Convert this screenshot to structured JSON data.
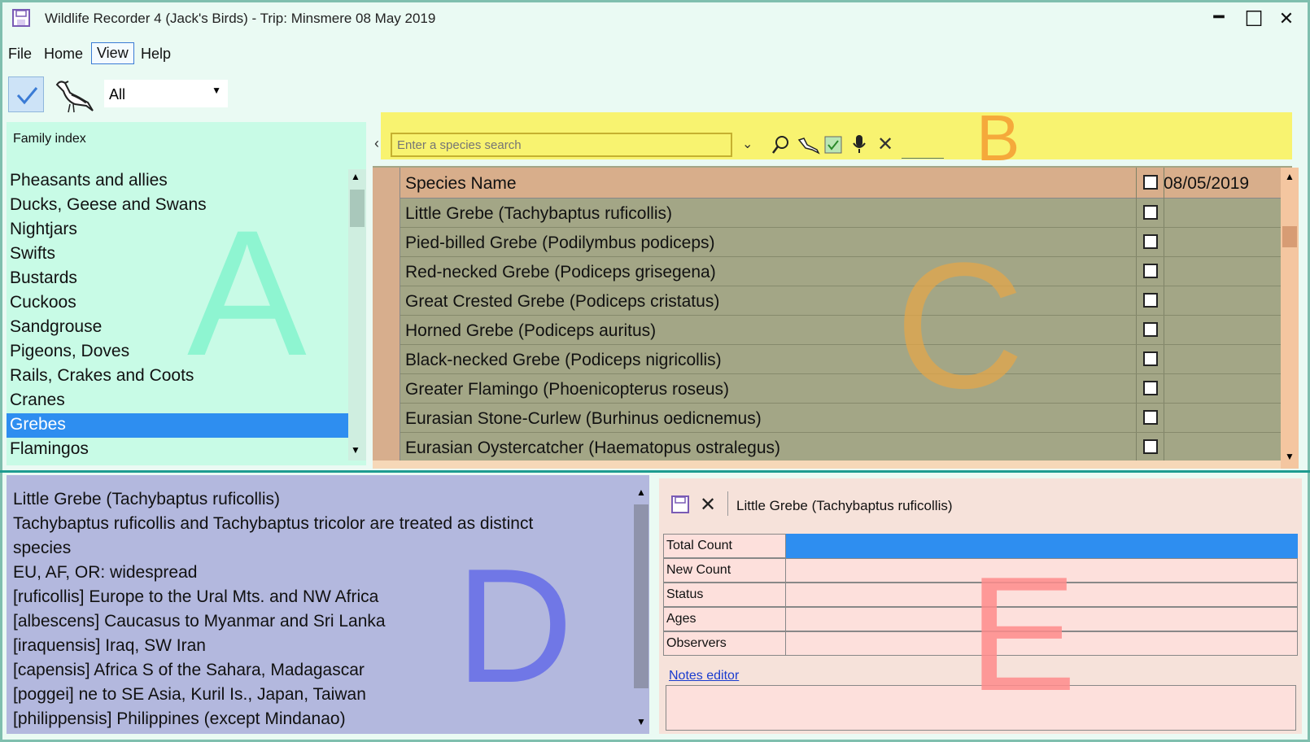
{
  "window": {
    "title": "Wildlife Recorder 4 (Jack's Birds) - Trip: Minsmere 08 May 2019",
    "minimize": "━",
    "maximize": "☐",
    "close": "✕"
  },
  "menu": {
    "items": [
      {
        "label": "File"
      },
      {
        "label": "Home"
      },
      {
        "label": "View"
      },
      {
        "label": "Help"
      }
    ]
  },
  "toolbar": {
    "filter_value": "All"
  },
  "family_index": {
    "header": "Family index",
    "items": [
      "Pheasants and allies",
      "Ducks, Geese and Swans",
      "Nightjars",
      "Swifts",
      "Bustards",
      "Cuckoos",
      "Sandgrouse",
      "Pigeons, Doves",
      "Rails, Crakes and Coots",
      "Cranes",
      "Grebes",
      "Flamingos"
    ],
    "selected": "Grebes"
  },
  "search": {
    "placeholder": "Enter a species search"
  },
  "species_table": {
    "header_name": "Species Name",
    "header_date": "08/05/2019",
    "rows": [
      "Little Grebe (Tachybaptus ruficollis)",
      "Pied-billed Grebe (Podilymbus podiceps)",
      "Red-necked Grebe (Podiceps grisegena)",
      "Great Crested Grebe (Podiceps cristatus)",
      "Horned Grebe (Podiceps auritus)",
      "Black-necked Grebe (Podiceps nigricollis)",
      "Greater Flamingo (Phoenicopterus roseus)",
      "Eurasian Stone-Curlew (Burhinus oedicnemus)",
      "Eurasian Oystercatcher (Haematopus ostralegus)"
    ]
  },
  "species_info": {
    "lines": [
      "Little Grebe (Tachybaptus ruficollis)",
      "Tachybaptus ruficollis and Tachybaptus tricolor are treated as distinct",
      "species",
      "EU, AF, OR: widespread",
      "[ruficollis] Europe to the Ural Mts. and NW Africa",
      "[albescens] Caucasus to Myanmar and Sri Lanka",
      "[iraquensis] Iraq, SW Iran",
      "[capensis] Africa S of the Sahara, Madagascar",
      "[poggei] ne to SE Asia, Kuril Is., Japan, Taiwan",
      "[philippensis] Philippines  (except Mindanao)"
    ]
  },
  "editor": {
    "title": "Little Grebe (Tachybaptus ruficollis)",
    "properties": [
      "Total Count",
      "New Count",
      "Status",
      "Ages",
      "Observers"
    ],
    "notes_link": "Notes editor"
  },
  "panel_labels": {
    "a": "A",
    "b": "B",
    "c": "C",
    "d": "D",
    "e": "E"
  },
  "colors": {
    "panel_a": "#c8fbe6",
    "panel_b": "#f8f370",
    "panel_c": "#a3a686",
    "panel_d": "#b3b8de",
    "panel_e": "#f6e2da",
    "selection": "#2e8ef0"
  }
}
